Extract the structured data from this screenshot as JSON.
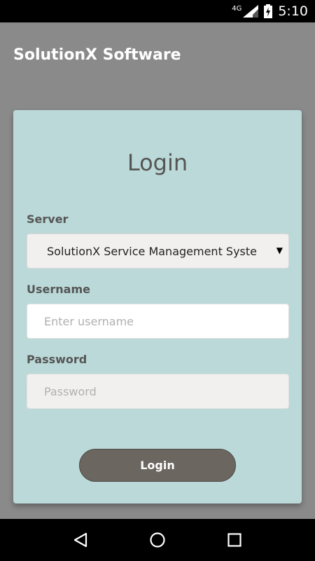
{
  "status_bar": {
    "network": "4G",
    "time": "5:10"
  },
  "app": {
    "title": "SolutionX Software"
  },
  "login_card": {
    "title": "Login",
    "server": {
      "label": "Server",
      "selected": "SolutionX Service Management Systen"
    },
    "username": {
      "label": "Username",
      "value": "",
      "placeholder": "Enter username"
    },
    "password": {
      "label": "Password",
      "value": "",
      "placeholder": "Password"
    },
    "login_button_label": "Login"
  },
  "nav_bar": {
    "back_icon": "back-triangle-icon",
    "home_icon": "home-circle-icon",
    "recents_icon": "recents-square-icon"
  },
  "colors": {
    "card_background": "#bbd9d8",
    "button": "#6b6660",
    "app_background": "#8a8a8a"
  }
}
